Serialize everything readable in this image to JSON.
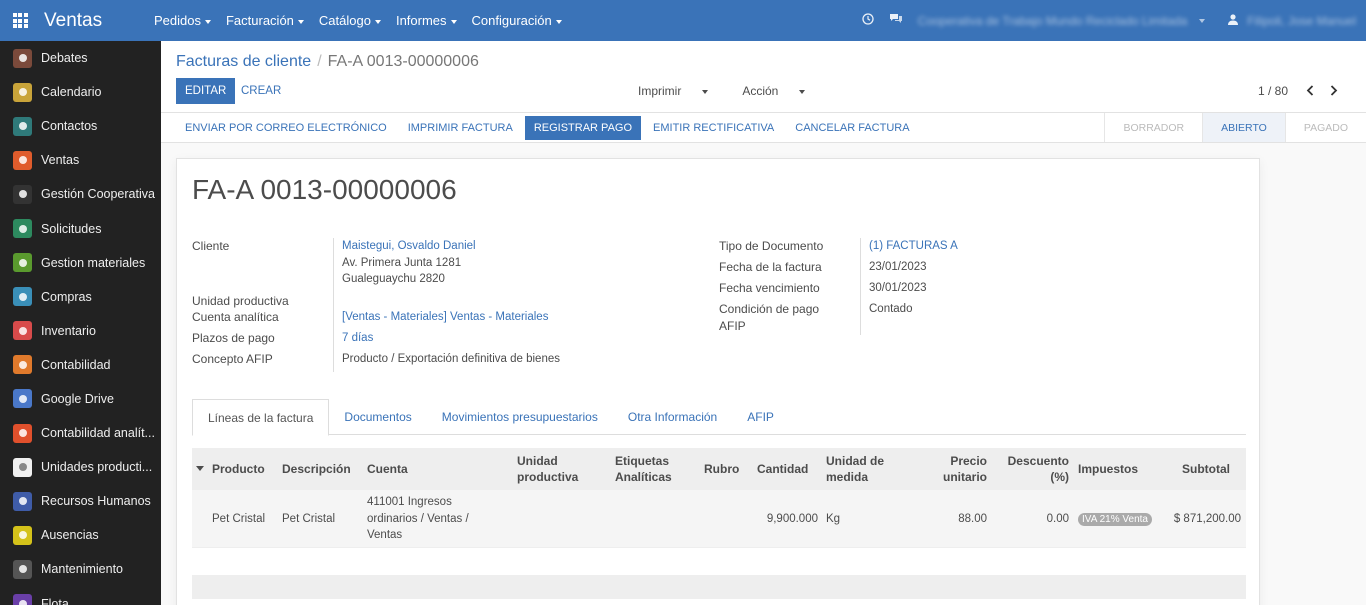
{
  "navbar": {
    "brand": "Ventas",
    "menu": [
      "Pedidos",
      "Facturación",
      "Catálogo",
      "Informes",
      "Configuración"
    ],
    "company": "Cooperativa de Trabajo Mundo Reciclado Limitada",
    "user": "Filipoli, Jose Manuel"
  },
  "sidebar": {
    "items": [
      {
        "label": "Debates",
        "color": "#7b4a3b",
        "icon": "chat-icon"
      },
      {
        "label": "Calendario",
        "color": "#c9a43a",
        "icon": "calendar-icon"
      },
      {
        "label": "Contactos",
        "color": "#2f7a7a",
        "icon": "contacts-icon"
      },
      {
        "label": "Ventas",
        "color": "#e05c2c",
        "icon": "chart-line-icon"
      },
      {
        "label": "Gestión Cooperativa",
        "color": "#333333",
        "icon": "gear-icon"
      },
      {
        "label": "Solicitudes",
        "color": "#2d8a5f",
        "icon": "megaphone-icon"
      },
      {
        "label": "Gestion materiales",
        "color": "#5a9a2e",
        "icon": "plant-icon"
      },
      {
        "label": "Compras",
        "color": "#3a8fb8",
        "icon": "credit-card-icon"
      },
      {
        "label": "Inventario",
        "color": "#d84b4b",
        "icon": "inventory-icon"
      },
      {
        "label": "Contabilidad",
        "color": "#e07a2c",
        "icon": "accounting-icon"
      },
      {
        "label": "Google Drive",
        "color": "#4a78c9",
        "icon": "drive-icon"
      },
      {
        "label": "Contabilidad analít...",
        "color": "#e0502c",
        "icon": "analytics-icon"
      },
      {
        "label": "Unidades producti...",
        "color": "#f0f0f0",
        "icon": "units-icon"
      },
      {
        "label": "Recursos Humanos",
        "color": "#3f5ca8",
        "icon": "people-icon"
      },
      {
        "label": "Ausencias",
        "color": "#d4c21a",
        "icon": "sun-icon"
      },
      {
        "label": "Mantenimiento",
        "color": "#555555",
        "icon": "hammer-icon"
      },
      {
        "label": "Flota",
        "color": "#6a3fa8",
        "icon": "car-icon"
      }
    ]
  },
  "control": {
    "breadcrumb_parent": "Facturas de cliente",
    "breadcrumb_current": "FA-A 0013-00000006",
    "edit_label": "EDITAR",
    "create_label": "CREAR",
    "print_label": "Imprimir",
    "action_label": "Acción",
    "pager": "1 / 80"
  },
  "statusbar": {
    "buttons": [
      "ENVIAR POR CORREO ELECTRÓNICO",
      "IMPRIMIR FACTURA",
      "REGISTRAR PAGO",
      "EMITIR RECTIFICATIVA",
      "CANCELAR FACTURA"
    ],
    "stages": [
      "BORRADOR",
      "ABIERTO",
      "PAGADO"
    ]
  },
  "invoice": {
    "title": "FA-A 0013-00000006",
    "cliente_label": "Cliente",
    "cliente_name": "Maistegui, Osvaldo Daniel",
    "cliente_addr1": "Av. Primera Junta 1281",
    "cliente_addr2": "Gualeguaychu 2820",
    "unidad_label": "Unidad productiva",
    "cuenta_label": "Cuenta analítica",
    "cuenta_value": "[Ventas - Materiales] Ventas - Materiales",
    "plazos_label": "Plazos de pago",
    "plazos_value": "7 días",
    "concepto_label": "Concepto AFIP",
    "concepto_value": "Producto / Exportación definitiva de bienes",
    "tipo_label": "Tipo de Documento",
    "tipo_value": "(1) FACTURAS A",
    "fecha_label": "Fecha de la factura",
    "fecha_value": "23/01/2023",
    "venc_label": "Fecha vencimiento",
    "venc_value": "30/01/2023",
    "cond_label1": "Condición de pago",
    "cond_label2": "AFIP",
    "cond_value": "Contado"
  },
  "tabs": [
    "Líneas de la factura",
    "Documentos",
    "Movimientos presupuestarios",
    "Otra Información",
    "AFIP"
  ],
  "table": {
    "headers": {
      "producto": "Producto",
      "descripcion": "Descripción",
      "cuenta": "Cuenta",
      "unidad1": "Unidad",
      "unidad2": "productiva",
      "etiquetas1": "Etiquetas",
      "etiquetas2": "Analíticas",
      "rubro": "Rubro",
      "cantidad": "Cantidad",
      "medida1": "Unidad de",
      "medida2": "medida",
      "precio1": "Precio",
      "precio2": "unitario",
      "descuento1": "Descuento",
      "descuento2": "(%)",
      "impuestos": "Impuestos",
      "subtotal": "Subtotal"
    },
    "row": {
      "producto": "Pet Cristal",
      "descripcion": "Pet Cristal",
      "cuenta1": "411001 Ingresos",
      "cuenta2": "ordinarios / Ventas /",
      "cuenta3": "Ventas",
      "cantidad": "9,900.000",
      "medida": "Kg",
      "precio": "88.00",
      "descuento": "0.00",
      "impuesto": "IVA 21% Venta",
      "subtotal": "$ 871,200.00"
    }
  }
}
